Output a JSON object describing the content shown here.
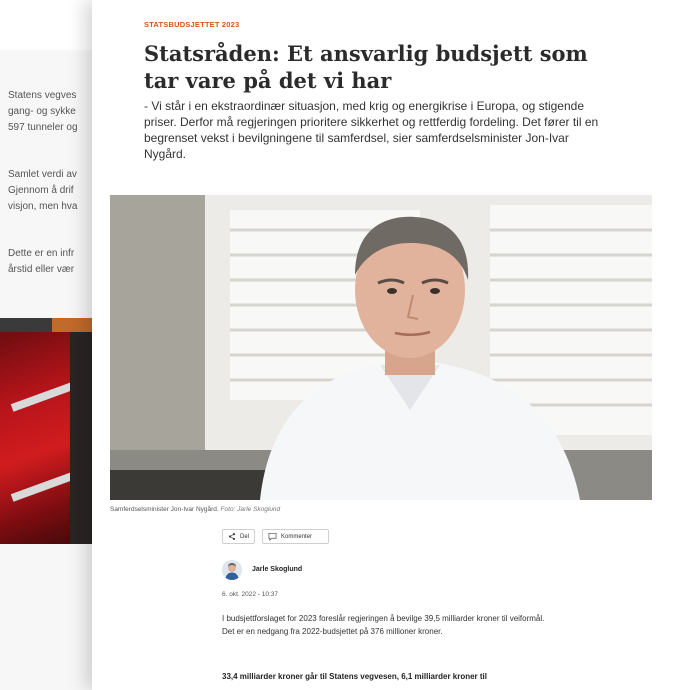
{
  "background_page": {
    "lines_block1": [
      "Statens vegves",
      "gang- og sykke",
      "597 tunneler og"
    ],
    "lines_block2": [
      "Samlet verdi av",
      "Gjennom å drif",
      "visjon, men hva"
    ],
    "lines_block3": [
      "Dette er en infr",
      "årstid eller vær"
    ]
  },
  "article": {
    "kicker": "STATSBUDSJETTET 2023",
    "title": "Statsråden: Et ansvarlig budsjett som tar vare på det vi har",
    "lead": "- Vi står i en ekstraordinær situasjon, med krig og energikrise i Europa, og stigende priser. Derfor må regjeringen prioritere sikkerhet og rettferdig fordeling. Det fører til en begrenset vekst i bevilgningene til samferdsel, sier samferdselsminister Jon-Ivar Nygård.",
    "caption": "Samferdselsminister Jon-Ivar Nygård.",
    "credit": "Foto: Jarle Skoglund",
    "share_label": "Del",
    "comment_label": "Kommenter",
    "author": "Jarle Skoglund",
    "date": "6. okt. 2022 - 10:37",
    "paragraph1": "I budsjettforslaget for 2023 foreslår regjeringen å bevilge 39,5 milliarder kroner til veiformål. Det er en nedgang fra 2022-budsjettet på 376 millioner kroner.",
    "paragraph2": "33,4 milliarder kroner går til Statens vegvesen, 6,1 milliarder kroner til"
  },
  "colors": {
    "kicker": "#d9531e",
    "title": "#2b2b2b",
    "bg_red": "#b5141a",
    "accent_orange": "#c06a2b"
  },
  "icons": [
    "share-icon",
    "comment-icon"
  ]
}
